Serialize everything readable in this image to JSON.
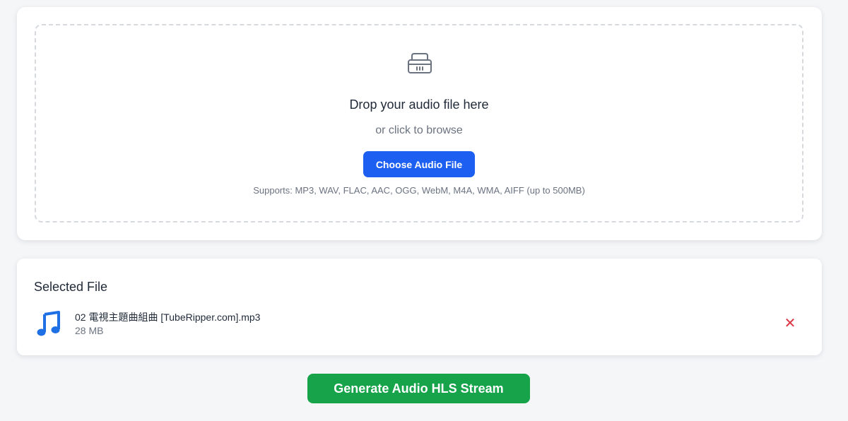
{
  "upload": {
    "icon": "inbox-tray-icon",
    "title": "Drop your audio file here",
    "subtitle": "or click to browse",
    "choose_label": "Choose Audio File",
    "supports": "Supports: MP3, WAV, FLAC, AAC, OGG, WebM, M4A, WMA, AIFF (up to 500MB)"
  },
  "selected": {
    "heading": "Selected File",
    "file_icon": "music-note-icon",
    "file_name": "02 電視主題曲組曲 [TubeRipper.com].mp3",
    "file_size": "28 MB",
    "remove_symbol": "✕",
    "remove_icon": "close-icon"
  },
  "actions": {
    "generate_label": "Generate Audio HLS Stream"
  },
  "colors": {
    "primary": "#1d5ff0",
    "success": "#16a34a",
    "danger": "#dc3545",
    "background": "#f5f6f8",
    "music_icon": "#1f6fe5"
  }
}
